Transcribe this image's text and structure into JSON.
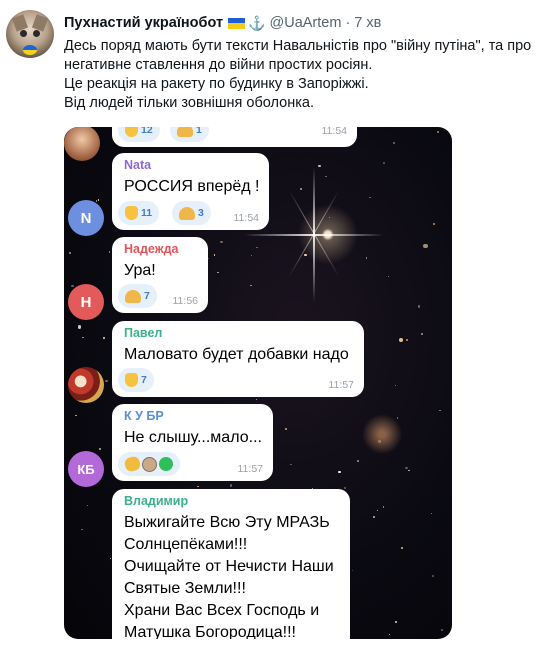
{
  "tweet": {
    "author_name": "Пухнастий українобот",
    "handle": "@UaArtem",
    "separator": "·",
    "time": "7 хв",
    "flag_icon": "ukraine-flag-icon",
    "anchor_icon": "anchor-icon",
    "text_lines": [
      "Десь поряд мають бути тексти Навальністів про \"війну путіна\", та про",
      "негативне ставлення до війни простих росіян.",
      "Це реакція на ракету по будинку в Запоріжжі.",
      "Від людей тільки зовнішня оболонка."
    ]
  },
  "chat": {
    "messages": [
      {
        "sender": "",
        "text": "",
        "time": "11:54",
        "reactions": [
          {
            "icon": "thumbs-up-icon",
            "count": "12"
          },
          {
            "icon": "pray-icon",
            "count": "1"
          }
        ]
      },
      {
        "sender": "Nata",
        "sender_color": "#8e6ad6",
        "avatar_letter": "N",
        "avatar_color": "#6c8fe0",
        "text": "РОССИЯ вперёд !",
        "time": "11:54",
        "reactions": [
          {
            "icon": "thumbs-up-icon",
            "count": "11"
          },
          {
            "icon": "pray-icon",
            "count": "3"
          }
        ]
      },
      {
        "sender": "Надежда",
        "sender_color": "#e2545b",
        "avatar_letter": "Н",
        "avatar_color": "#e35a5a",
        "text": "Ура!",
        "time": "11:56",
        "reactions": [
          {
            "icon": "pray-icon",
            "count": "7"
          }
        ]
      },
      {
        "sender": "Павел",
        "sender_color": "#3bb08a",
        "avatar_icon": "user-photo-avatar-icon",
        "text": "Маловато будет добавки надо",
        "time": "11:57",
        "reactions": [
          {
            "icon": "thumbs-up-icon",
            "count": "7"
          }
        ]
      },
      {
        "sender": "К У БР",
        "sender_color": "#5a8fd8",
        "avatar_letter": "КБ",
        "avatar_color": "#b36ad8",
        "text": "Не слышу...мало...",
        "time": "11:57",
        "reactions": [
          {
            "icon": "clap-icon",
            "count": ""
          },
          {
            "icon": "face-avatar-icon",
            "count": ""
          },
          {
            "icon": "green-dot-icon",
            "count": ""
          }
        ]
      },
      {
        "sender": "Владимир",
        "sender_color": "#3bb08a",
        "text_lines": [
          "Выжигайте Всю Эту МРАЗЬ",
          "Солнцепёками!!!",
          "Очищайте от Нечисти Наши",
          "Святые Земли!!!",
          "Храни Вас Всех Господь и",
          "Матушка Богородица!!!"
        ]
      }
    ]
  }
}
